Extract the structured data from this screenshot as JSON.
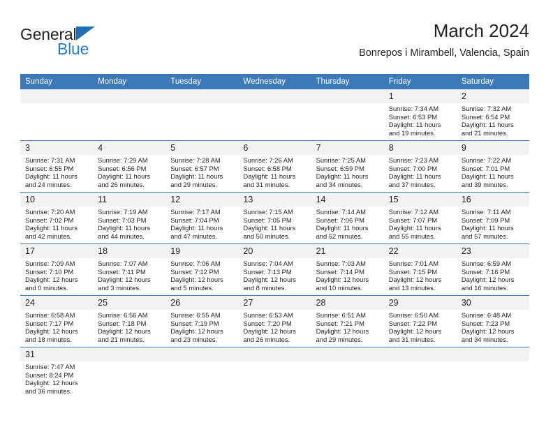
{
  "brand": {
    "name_part1": "General",
    "name_part2": "Blue",
    "triangle_color": "#1f6fb5",
    "blue_color": "#2b7cc2"
  },
  "header": {
    "title": "March 2024",
    "subtitle": "Bonrepos i Mirambell, Valencia, Spain",
    "header_bg_color": "#3b79b8",
    "daynum_bg_color": "#f2f2f2"
  },
  "weekdays": [
    "Sunday",
    "Monday",
    "Tuesday",
    "Wednesday",
    "Thursday",
    "Friday",
    "Saturday"
  ],
  "labels": {
    "sunrise_prefix": "Sunrise: ",
    "sunset_prefix": "Sunset: ",
    "daylight_prefix": "Daylight: "
  },
  "weeks": [
    [
      {
        "blank": true,
        "day": "",
        "sunrise": "",
        "sunset": "",
        "daylight_line1": "",
        "daylight_line2": ""
      },
      {
        "blank": true,
        "day": "",
        "sunrise": "",
        "sunset": "",
        "daylight_line1": "",
        "daylight_line2": ""
      },
      {
        "blank": true,
        "day": "",
        "sunrise": "",
        "sunset": "",
        "daylight_line1": "",
        "daylight_line2": ""
      },
      {
        "blank": true,
        "day": "",
        "sunrise": "",
        "sunset": "",
        "daylight_line1": "",
        "daylight_line2": ""
      },
      {
        "blank": true,
        "day": "",
        "sunrise": "",
        "sunset": "",
        "daylight_line1": "",
        "daylight_line2": ""
      },
      {
        "blank": false,
        "day": "1",
        "sunrise": "Sunrise: 7:34 AM",
        "sunset": "Sunset: 6:53 PM",
        "daylight_line1": "Daylight: 11 hours",
        "daylight_line2": "and 19 minutes."
      },
      {
        "blank": false,
        "day": "2",
        "sunrise": "Sunrise: 7:32 AM",
        "sunset": "Sunset: 6:54 PM",
        "daylight_line1": "Daylight: 11 hours",
        "daylight_line2": "and 21 minutes."
      }
    ],
    [
      {
        "blank": false,
        "day": "3",
        "sunrise": "Sunrise: 7:31 AM",
        "sunset": "Sunset: 6:55 PM",
        "daylight_line1": "Daylight: 11 hours",
        "daylight_line2": "and 24 minutes."
      },
      {
        "blank": false,
        "day": "4",
        "sunrise": "Sunrise: 7:29 AM",
        "sunset": "Sunset: 6:56 PM",
        "daylight_line1": "Daylight: 11 hours",
        "daylight_line2": "and 26 minutes."
      },
      {
        "blank": false,
        "day": "5",
        "sunrise": "Sunrise: 7:28 AM",
        "sunset": "Sunset: 6:57 PM",
        "daylight_line1": "Daylight: 11 hours",
        "daylight_line2": "and 29 minutes."
      },
      {
        "blank": false,
        "day": "6",
        "sunrise": "Sunrise: 7:26 AM",
        "sunset": "Sunset: 6:58 PM",
        "daylight_line1": "Daylight: 11 hours",
        "daylight_line2": "and 31 minutes."
      },
      {
        "blank": false,
        "day": "7",
        "sunrise": "Sunrise: 7:25 AM",
        "sunset": "Sunset: 6:59 PM",
        "daylight_line1": "Daylight: 11 hours",
        "daylight_line2": "and 34 minutes."
      },
      {
        "blank": false,
        "day": "8",
        "sunrise": "Sunrise: 7:23 AM",
        "sunset": "Sunset: 7:00 PM",
        "daylight_line1": "Daylight: 11 hours",
        "daylight_line2": "and 37 minutes."
      },
      {
        "blank": false,
        "day": "9",
        "sunrise": "Sunrise: 7:22 AM",
        "sunset": "Sunset: 7:01 PM",
        "daylight_line1": "Daylight: 11 hours",
        "daylight_line2": "and 39 minutes."
      }
    ],
    [
      {
        "blank": false,
        "day": "10",
        "sunrise": "Sunrise: 7:20 AM",
        "sunset": "Sunset: 7:02 PM",
        "daylight_line1": "Daylight: 11 hours",
        "daylight_line2": "and 42 minutes."
      },
      {
        "blank": false,
        "day": "11",
        "sunrise": "Sunrise: 7:19 AM",
        "sunset": "Sunset: 7:03 PM",
        "daylight_line1": "Daylight: 11 hours",
        "daylight_line2": "and 44 minutes."
      },
      {
        "blank": false,
        "day": "12",
        "sunrise": "Sunrise: 7:17 AM",
        "sunset": "Sunset: 7:04 PM",
        "daylight_line1": "Daylight: 11 hours",
        "daylight_line2": "and 47 minutes."
      },
      {
        "blank": false,
        "day": "13",
        "sunrise": "Sunrise: 7:15 AM",
        "sunset": "Sunset: 7:05 PM",
        "daylight_line1": "Daylight: 11 hours",
        "daylight_line2": "and 50 minutes."
      },
      {
        "blank": false,
        "day": "14",
        "sunrise": "Sunrise: 7:14 AM",
        "sunset": "Sunset: 7:06 PM",
        "daylight_line1": "Daylight: 11 hours",
        "daylight_line2": "and 52 minutes."
      },
      {
        "blank": false,
        "day": "15",
        "sunrise": "Sunrise: 7:12 AM",
        "sunset": "Sunset: 7:07 PM",
        "daylight_line1": "Daylight: 11 hours",
        "daylight_line2": "and 55 minutes."
      },
      {
        "blank": false,
        "day": "16",
        "sunrise": "Sunrise: 7:11 AM",
        "sunset": "Sunset: 7:09 PM",
        "daylight_line1": "Daylight: 11 hours",
        "daylight_line2": "and 57 minutes."
      }
    ],
    [
      {
        "blank": false,
        "day": "17",
        "sunrise": "Sunrise: 7:09 AM",
        "sunset": "Sunset: 7:10 PM",
        "daylight_line1": "Daylight: 12 hours",
        "daylight_line2": "and 0 minutes."
      },
      {
        "blank": false,
        "day": "18",
        "sunrise": "Sunrise: 7:07 AM",
        "sunset": "Sunset: 7:11 PM",
        "daylight_line1": "Daylight: 12 hours",
        "daylight_line2": "and 3 minutes."
      },
      {
        "blank": false,
        "day": "19",
        "sunrise": "Sunrise: 7:06 AM",
        "sunset": "Sunset: 7:12 PM",
        "daylight_line1": "Daylight: 12 hours",
        "daylight_line2": "and 5 minutes."
      },
      {
        "blank": false,
        "day": "20",
        "sunrise": "Sunrise: 7:04 AM",
        "sunset": "Sunset: 7:13 PM",
        "daylight_line1": "Daylight: 12 hours",
        "daylight_line2": "and 8 minutes."
      },
      {
        "blank": false,
        "day": "21",
        "sunrise": "Sunrise: 7:03 AM",
        "sunset": "Sunset: 7:14 PM",
        "daylight_line1": "Daylight: 12 hours",
        "daylight_line2": "and 10 minutes."
      },
      {
        "blank": false,
        "day": "22",
        "sunrise": "Sunrise: 7:01 AM",
        "sunset": "Sunset: 7:15 PM",
        "daylight_line1": "Daylight: 12 hours",
        "daylight_line2": "and 13 minutes."
      },
      {
        "blank": false,
        "day": "23",
        "sunrise": "Sunrise: 6:59 AM",
        "sunset": "Sunset: 7:16 PM",
        "daylight_line1": "Daylight: 12 hours",
        "daylight_line2": "and 16 minutes."
      }
    ],
    [
      {
        "blank": false,
        "day": "24",
        "sunrise": "Sunrise: 6:58 AM",
        "sunset": "Sunset: 7:17 PM",
        "daylight_line1": "Daylight: 12 hours",
        "daylight_line2": "and 18 minutes."
      },
      {
        "blank": false,
        "day": "25",
        "sunrise": "Sunrise: 6:56 AM",
        "sunset": "Sunset: 7:18 PM",
        "daylight_line1": "Daylight: 12 hours",
        "daylight_line2": "and 21 minutes."
      },
      {
        "blank": false,
        "day": "26",
        "sunrise": "Sunrise: 6:55 AM",
        "sunset": "Sunset: 7:19 PM",
        "daylight_line1": "Daylight: 12 hours",
        "daylight_line2": "and 23 minutes."
      },
      {
        "blank": false,
        "day": "27",
        "sunrise": "Sunrise: 6:53 AM",
        "sunset": "Sunset: 7:20 PM",
        "daylight_line1": "Daylight: 12 hours",
        "daylight_line2": "and 26 minutes."
      },
      {
        "blank": false,
        "day": "28",
        "sunrise": "Sunrise: 6:51 AM",
        "sunset": "Sunset: 7:21 PM",
        "daylight_line1": "Daylight: 12 hours",
        "daylight_line2": "and 29 minutes."
      },
      {
        "blank": false,
        "day": "29",
        "sunrise": "Sunrise: 6:50 AM",
        "sunset": "Sunset: 7:22 PM",
        "daylight_line1": "Daylight: 12 hours",
        "daylight_line2": "and 31 minutes."
      },
      {
        "blank": false,
        "day": "30",
        "sunrise": "Sunrise: 6:48 AM",
        "sunset": "Sunset: 7:23 PM",
        "daylight_line1": "Daylight: 12 hours",
        "daylight_line2": "and 34 minutes."
      }
    ],
    [
      {
        "blank": false,
        "day": "31",
        "sunrise": "Sunrise: 7:47 AM",
        "sunset": "Sunset: 8:24 PM",
        "daylight_line1": "Daylight: 12 hours",
        "daylight_line2": "and 36 minutes."
      },
      {
        "blank": true,
        "day": "",
        "sunrise": "",
        "sunset": "",
        "daylight_line1": "",
        "daylight_line2": ""
      },
      {
        "blank": true,
        "day": "",
        "sunrise": "",
        "sunset": "",
        "daylight_line1": "",
        "daylight_line2": ""
      },
      {
        "blank": true,
        "day": "",
        "sunrise": "",
        "sunset": "",
        "daylight_line1": "",
        "daylight_line2": ""
      },
      {
        "blank": true,
        "day": "",
        "sunrise": "",
        "sunset": "",
        "daylight_line1": "",
        "daylight_line2": ""
      },
      {
        "blank": true,
        "day": "",
        "sunrise": "",
        "sunset": "",
        "daylight_line1": "",
        "daylight_line2": ""
      },
      {
        "blank": true,
        "day": "",
        "sunrise": "",
        "sunset": "",
        "daylight_line1": "",
        "daylight_line2": ""
      }
    ]
  ]
}
